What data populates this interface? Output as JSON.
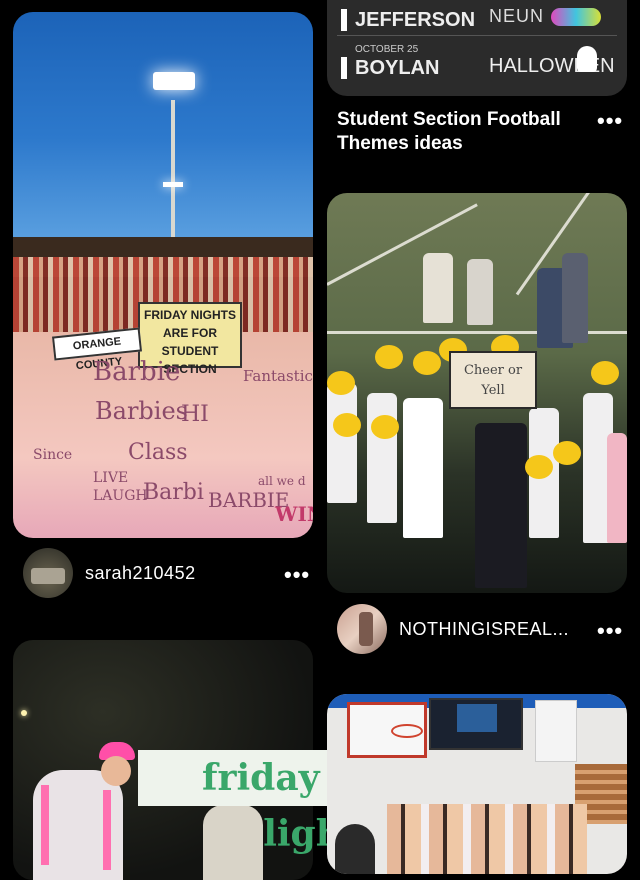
{
  "cards": {
    "stadium": {
      "signs": [
        "FRIDAY NIGHTS",
        "ARE FOR",
        "STUDENT SECTION",
        "ORANGE COUNTY"
      ],
      "banner_words": [
        "Barbie",
        "Barbies",
        "HI",
        "Since",
        "LIVE",
        "LAUGH",
        "Barbi",
        "BARBIE",
        "Fantastic",
        "WIN",
        "Class",
        "all we d"
      ]
    },
    "theme": {
      "rows": [
        {
          "date": "",
          "name": "JEFFERSON",
          "right": "NEUN"
        },
        {
          "date": "OCTOBER 25",
          "name": "BOYLAN",
          "right": "HALLOWEEN"
        }
      ],
      "title_line1": "Student Section Football",
      "title_line2": "Themes ideas",
      "more": "•••"
    },
    "cheer": {
      "sign_text": "Cheer or Yell",
      "username": "NOTHINGISREAL...",
      "more": "•••"
    },
    "fnl": {
      "overlay": "friday night lights"
    },
    "gym": {}
  },
  "stadium_user": {
    "username": "sarah210452",
    "more": "•••"
  },
  "colors": {
    "background": "#000000",
    "overlay_text": "#3aa76a"
  }
}
